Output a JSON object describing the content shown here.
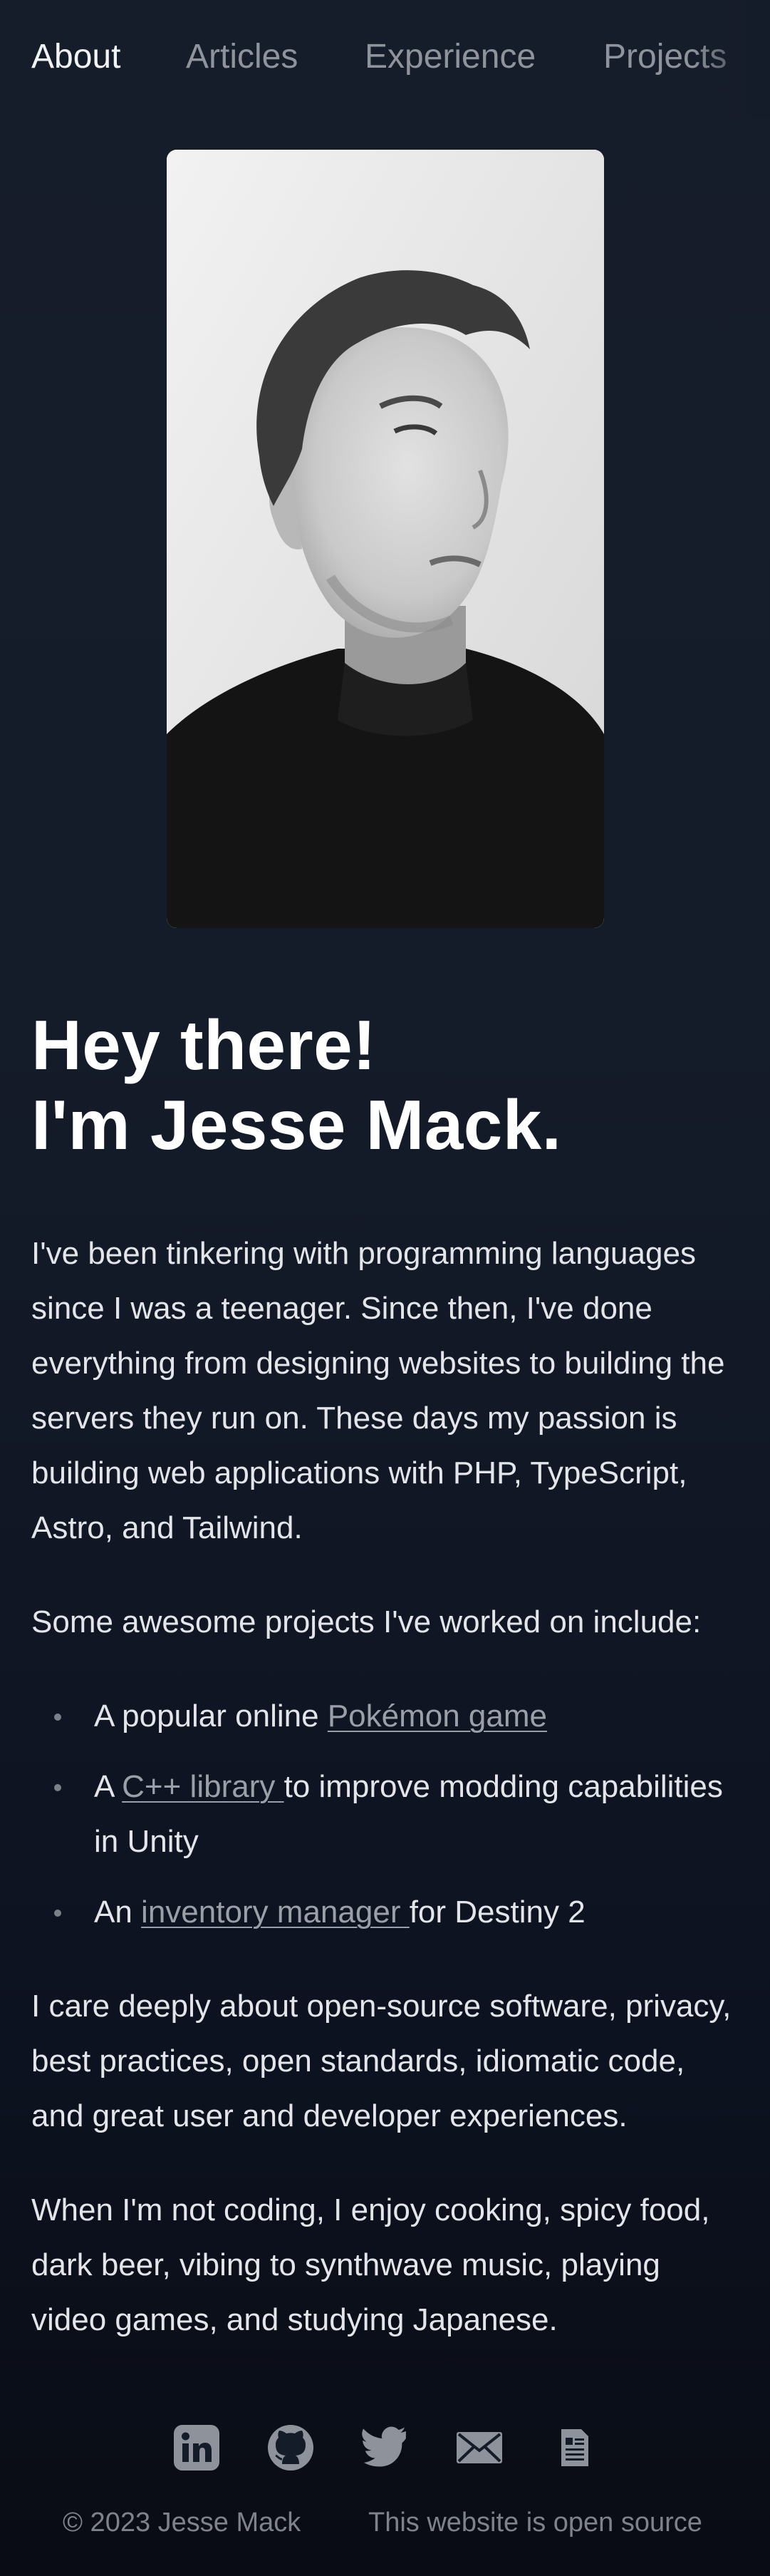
{
  "nav": {
    "items": [
      {
        "label": "About",
        "active": true
      },
      {
        "label": "Articles",
        "active": false
      },
      {
        "label": "Experience",
        "active": false
      },
      {
        "label": "Projects",
        "active": false
      }
    ]
  },
  "hero": {
    "greeting_line1": "Hey there!",
    "greeting_line2": "I'm Jesse Mack."
  },
  "intro": {
    "p1": "I've been tinkering with programming languages since I was a teenager. Since then, I've done everything from designing websites to building the servers they run on. These days my passion is building web applications with PHP, TypeScript, Astro, and Tailwind.",
    "projects_lead": "Some awesome projects I've worked on include:",
    "projects": [
      {
        "before": "A popular online ",
        "link": "Pokémon game",
        "after": ""
      },
      {
        "before": "A ",
        "link": "C++ library ",
        "after": "to improve modding capabilities in Unity"
      },
      {
        "before": "An ",
        "link": "inventory manager ",
        "after": "for Destiny 2"
      }
    ],
    "p2": "I care deeply about open-source software, privacy, best practices, open standards, idiomatic code, and great user and developer experiences.",
    "p3": "When I'm not coding, I enjoy cooking, spicy food, dark beer, vibing to synthwave music, playing video games, and studying Japanese."
  },
  "footer": {
    "icons": [
      "linkedin-icon",
      "github-icon",
      "twitter-icon",
      "email-icon",
      "resume-icon"
    ],
    "copyright": "© 2023 Jesse Mack",
    "source_link": "This website is open source"
  },
  "colors": {
    "background": "#141b29",
    "text": "#e6e8ec",
    "muted": "#8f949c",
    "link": "#9b9fa8"
  }
}
